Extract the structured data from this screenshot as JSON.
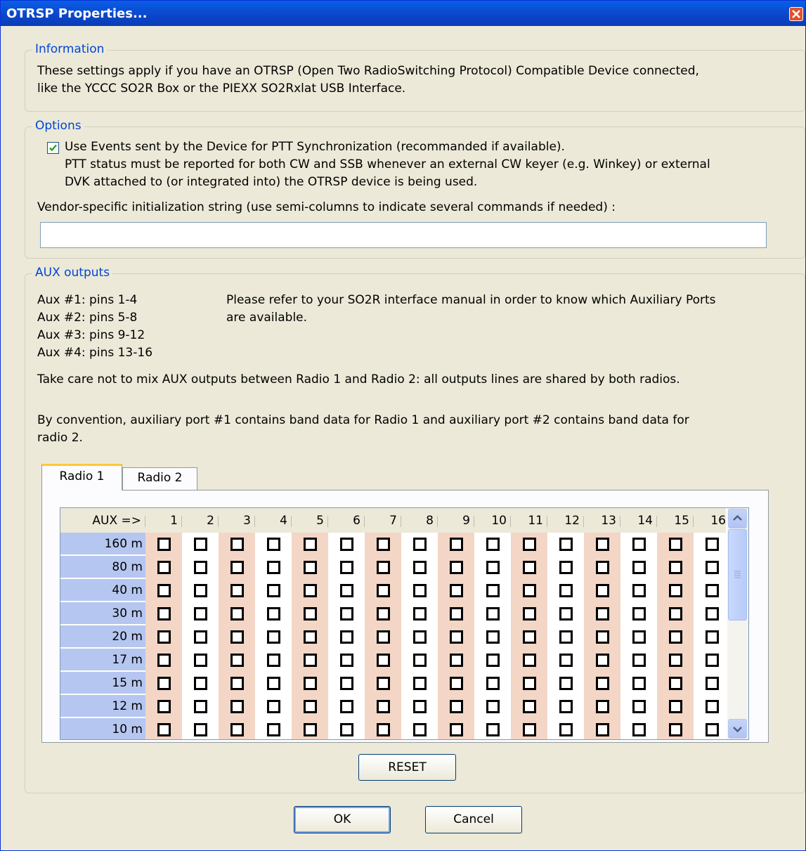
{
  "window": {
    "title": "OTRSP Properties..."
  },
  "information": {
    "legend": "Information",
    "line1": "These settings apply if you have an OTRSP (Open Two RadioSwitching Protocol) Compatible Device connected,",
    "line2": "like the YCCC SO2R Box or the PIEXX SO2Rxlat USB Interface."
  },
  "options": {
    "legend": "Options",
    "ptt_checkbox_label": "Use Events sent by the Device for PTT Synchronization (recommanded if available).",
    "ptt_checked": true,
    "ptt_note1": "PTT status must be reported for both CW and SSB whenever an external CW keyer (e.g. Winkey) or external",
    "ptt_note2": "DVK attached to (or integrated into) the OTRSP device is being used.",
    "init_label": "Vendor-specific initialization string (use semi-columns to indicate several commands if needed) :",
    "init_value": ""
  },
  "aux": {
    "legend": "AUX outputs",
    "ports": [
      "Aux #1: pins 1-4",
      "Aux #2: pins 5-8",
      "Aux #3: pins 9-12",
      "Aux #4: pins 13-16"
    ],
    "refer1": "Please refer to your SO2R interface manual in order to know which Auxiliary Ports",
    "refer2": "are available.",
    "care": "Take care not to mix AUX outputs between Radio 1 and Radio 2: all outputs lines are shared by both radios.",
    "convention1": "By convention, auxiliary port #1 contains band data for Radio 1 and auxiliary port #2 contains band data for",
    "convention2": "radio 2.",
    "tabs": [
      "Radio 1",
      "Radio 2"
    ],
    "active_tab": "Radio 1",
    "grid": {
      "corner": "AUX =>",
      "columns": [
        "1",
        "2",
        "3",
        "4",
        "5",
        "6",
        "7",
        "8",
        "9",
        "10",
        "11",
        "12",
        "13",
        "14",
        "15",
        "16"
      ],
      "bands": [
        "160 m",
        "80 m",
        "40 m",
        "30 m",
        "20 m",
        "17 m",
        "15 m",
        "12 m",
        "10 m"
      ]
    },
    "reset_label": "RESET"
  },
  "buttons": {
    "ok": "OK",
    "cancel": "Cancel"
  }
}
